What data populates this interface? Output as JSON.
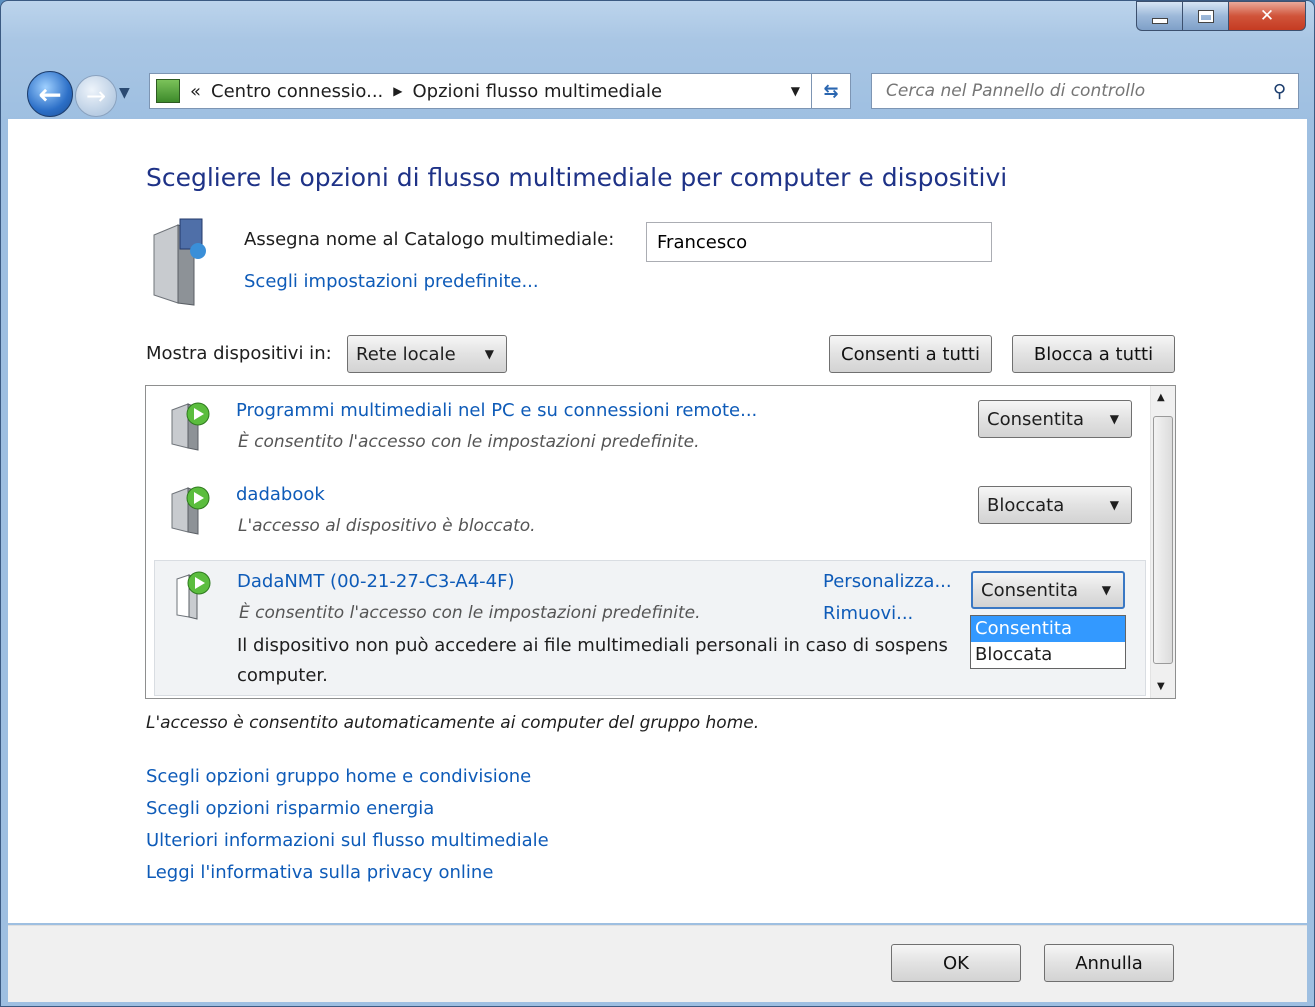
{
  "nav": {
    "crumb1": "Centro connessio...",
    "crumb2": "Opzioni flusso multimediale",
    "search_placeholder": "Cerca nel Pannello di controllo",
    "history_prefix": "«"
  },
  "page": {
    "title": "Scegliere le opzioni di flusso multimediale per computer e dispositivi",
    "name_label": "Assegna nome al Catalogo multimediale:",
    "name_value": "Francesco",
    "defaults_link": "Scegli impostazioni predefinite...",
    "show_label": "Mostra dispositivi in:",
    "show_value": "Rete locale",
    "allow_all": "Consenti a tutti",
    "block_all": "Blocca a tutti"
  },
  "devices": [
    {
      "title": "Programmi multimediali nel PC e su connessioni remote...",
      "subtitle": "È consentito l'accesso con le impostazioni predefinite.",
      "state": "Consentita"
    },
    {
      "title": "dadabook",
      "subtitle": "L'accesso al dispositivo è bloccato.",
      "state": "Bloccata"
    },
    {
      "title": "DadaNMT (00-21-27-C3-A4-4F)",
      "subtitle": "È consentito l'accesso con le impostazioni predefinite.",
      "state": "Consentita",
      "customize": "Personalizza...",
      "remove": "Rimuovi...",
      "warning_line1": "Il dispositivo non può accedere ai file multimediali personali in caso di sospens",
      "warning_line2": "computer."
    }
  ],
  "dropdown_options": [
    "Consentita",
    "Bloccata"
  ],
  "note": "L'accesso è consentito automaticamente ai computer del gruppo home.",
  "links": [
    "Scegli opzioni gruppo home e condivisione",
    "Scegli opzioni risparmio energia",
    "Ulteriori informazioni sul flusso multimediale",
    "Leggi l'informativa sulla privacy online"
  ],
  "footer": {
    "ok": "OK",
    "cancel": "Annulla"
  },
  "colors": {
    "title": "#1e3287",
    "link": "#0e5bb8",
    "highlight": "#3399ff"
  }
}
